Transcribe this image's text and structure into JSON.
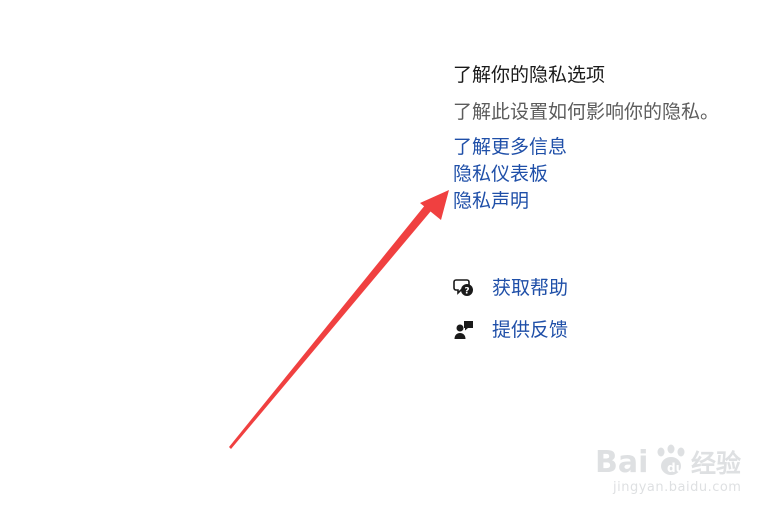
{
  "privacy": {
    "title": "了解你的隐私选项",
    "subtitle": "了解此设置如何影响你的隐私。",
    "links": [
      "了解更多信息",
      "隐私仪表板",
      "隐私声明"
    ]
  },
  "support": {
    "get_help": "获取帮助",
    "give_feedback": "提供反馈"
  },
  "annotation": {
    "arrow_color": "#f04040"
  },
  "watermark": {
    "brand": "Bai 经验",
    "url": "jingyan.baidu.com"
  }
}
